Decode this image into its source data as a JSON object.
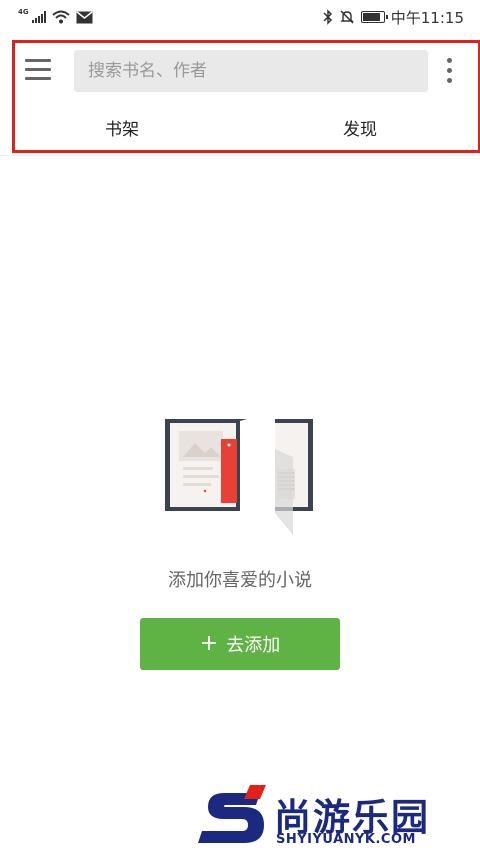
{
  "status_bar": {
    "network": "4G",
    "time": "中午11:15"
  },
  "header": {
    "search": {
      "placeholder": "搜索书名、作者",
      "value": ""
    },
    "tabs": [
      {
        "label": "书架"
      },
      {
        "label": "发现"
      }
    ],
    "highlight_color": "#e0211a"
  },
  "empty_state": {
    "message": "添加你喜爱的小说",
    "button_icon": "+",
    "button_label": "去添加",
    "button_color": "#5fb244"
  },
  "watermark": {
    "name": "尚游乐园",
    "url": "SHYIYUANYK.COM"
  }
}
